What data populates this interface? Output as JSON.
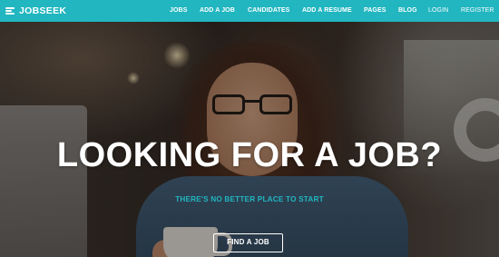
{
  "brand": {
    "name": "JOBSEEK",
    "icon": "menu-lines-icon"
  },
  "nav": {
    "items": [
      "JOBS",
      "ADD A JOB",
      "CANDIDATES",
      "ADD A RESUME",
      "PAGES",
      "BLOG"
    ],
    "login": "LOGIN",
    "register": "REGISTER"
  },
  "hero": {
    "headline": "LOOKING FOR A JOB?",
    "subheadline": "THERE'S NO BETTER PLACE TO START",
    "cta_label": "FIND A JOB"
  },
  "colors": {
    "accent": "#21b6c0",
    "text_on_dark": "#ffffff"
  }
}
